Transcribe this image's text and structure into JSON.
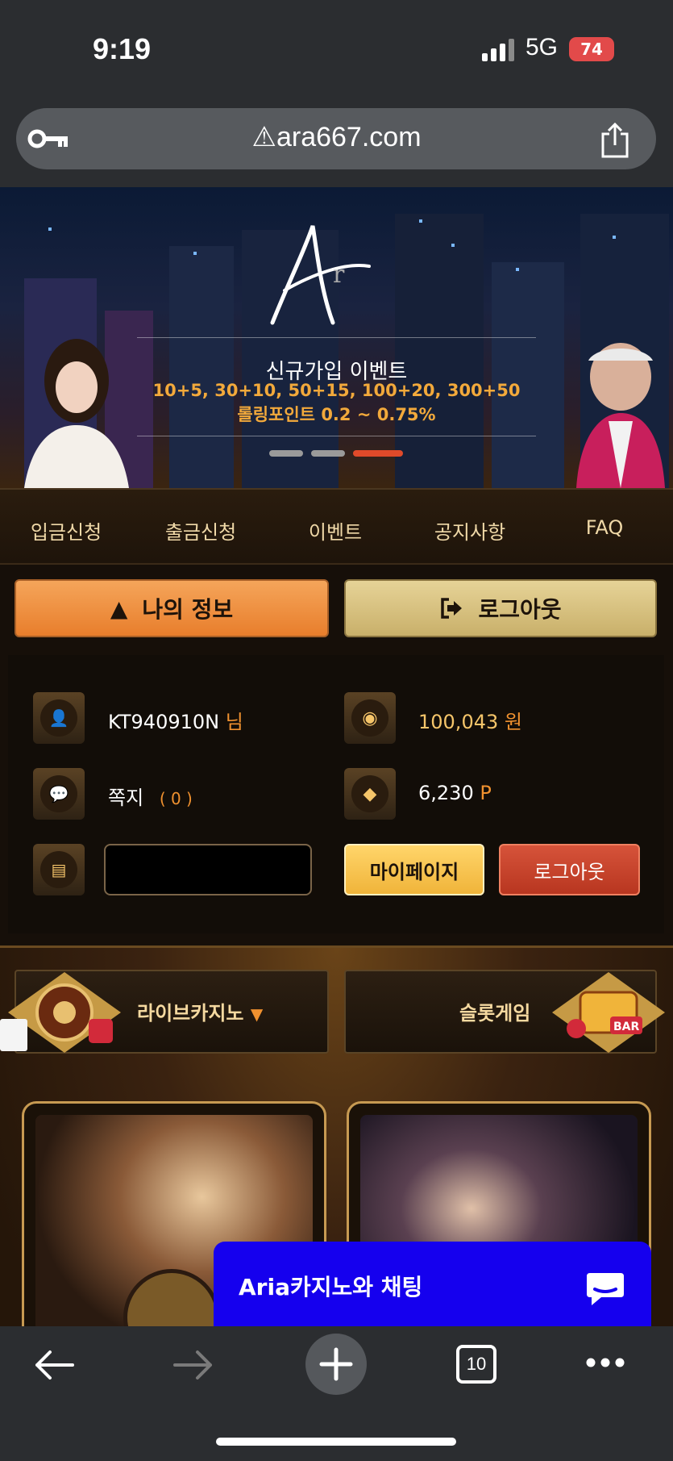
{
  "status_bar": {
    "time": "9:19",
    "network": "5G",
    "battery": "74"
  },
  "browser": {
    "url": "ara667.com"
  },
  "banner": {
    "title": "신규가입 이벤트",
    "line1": "10+5, 30+10, 50+15, 100+20, 300+50",
    "line2": "롤링포인트 0.2 ~ 0.75%",
    "slides": 3,
    "active_slide": 3
  },
  "nav": {
    "items": [
      "입금신청",
      "출금신청",
      "이벤트",
      "공지사항",
      "FAQ"
    ]
  },
  "account_buttons": {
    "my_info": "나의 정보",
    "logout": "로그아웃"
  },
  "user_info": {
    "username": "KT940910N",
    "honorific": "님",
    "balance": "100,043",
    "currency": "원",
    "messages_label": "쪽지",
    "messages_count": "( 0 )",
    "points": "6,230",
    "points_unit": "P",
    "mypage_button": "마이페이지",
    "logout_button": "로그아웃"
  },
  "game_tabs": {
    "live_casino": "라이브카지노",
    "slot_game": "슬롯게임"
  },
  "chat_widget": {
    "label": "Aria카지노와 채팅"
  },
  "browser_bottom": {
    "tab_count": "10"
  },
  "colors": {
    "accent_orange": "#f0912f",
    "gold": "#f5c56a",
    "chat_blue": "#1500ee"
  }
}
